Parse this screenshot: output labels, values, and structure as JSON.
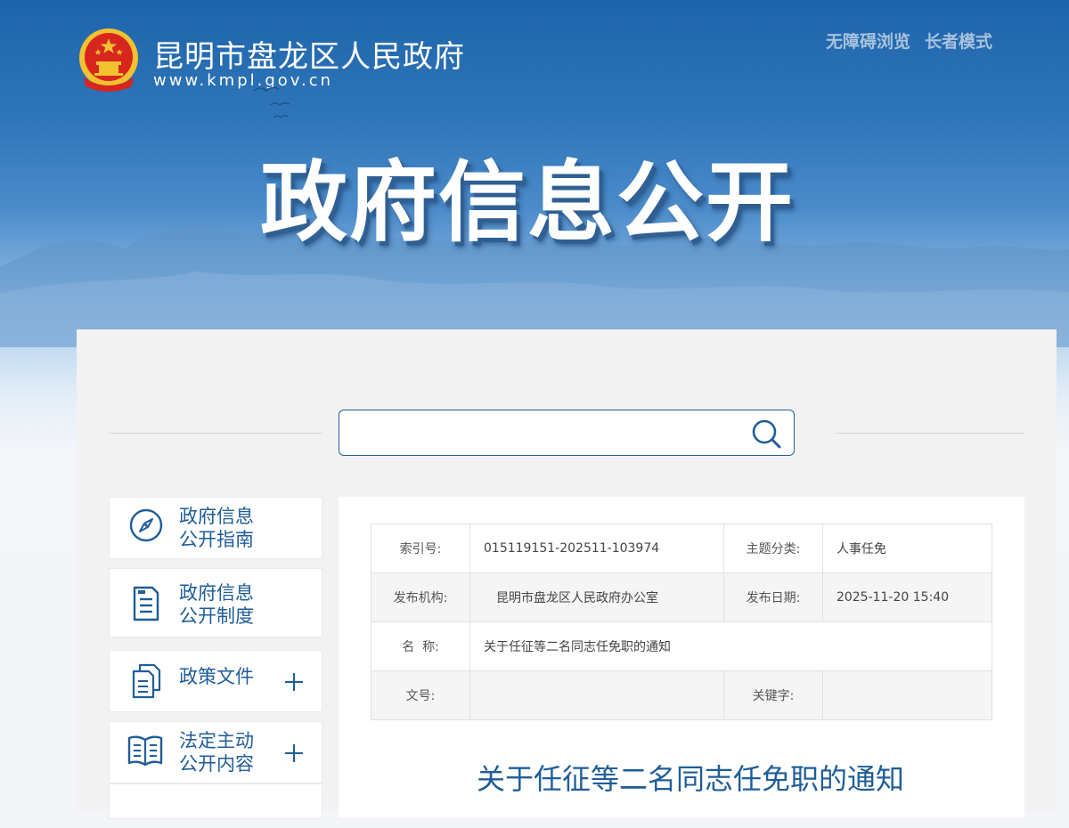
{
  "header": {
    "site_name": "昆明市盘龙区人民政府",
    "site_url": "www.kmpl.gov.cn",
    "links": [
      "无障碍浏览",
      "长者模式"
    ],
    "hero_title": "政府信息公开"
  },
  "search": {
    "placeholder": "",
    "value": "",
    "icon": "search-icon"
  },
  "sidebar": {
    "items": [
      {
        "label": "政府信息\n公开指南",
        "icon": "compass-icon",
        "expandable": false
      },
      {
        "label": "政府信息\n公开制度",
        "icon": "document-icon",
        "expandable": false
      },
      {
        "label": "政策文件",
        "icon": "files-icon",
        "expandable": true
      },
      {
        "label": "法定主动\n公开内容",
        "icon": "book-icon",
        "expandable": true
      }
    ]
  },
  "meta": {
    "index_label": "索引号:",
    "index_value": "015119151-202511-103974",
    "topic_label": "主题分类:",
    "topic_value": "人事任免",
    "publisher_label": "发布机构:",
    "publisher_value": "昆明市盘龙区人民政府办公室",
    "date_label": "发布日期:",
    "date_value": "2025-11-20 15:40",
    "name_label": "名  称:",
    "name_value": "关于任征等二名同志任免职的通知",
    "docno_label": "文号:",
    "docno_value": "",
    "keyword_label": "关键字:",
    "keyword_value": ""
  },
  "article": {
    "title": "关于任征等二名同志任免职的通知"
  },
  "colors": {
    "brand_blue": "#1f5d99",
    "emblem_red": "#d7261e",
    "emblem_gold": "#f2c230"
  }
}
